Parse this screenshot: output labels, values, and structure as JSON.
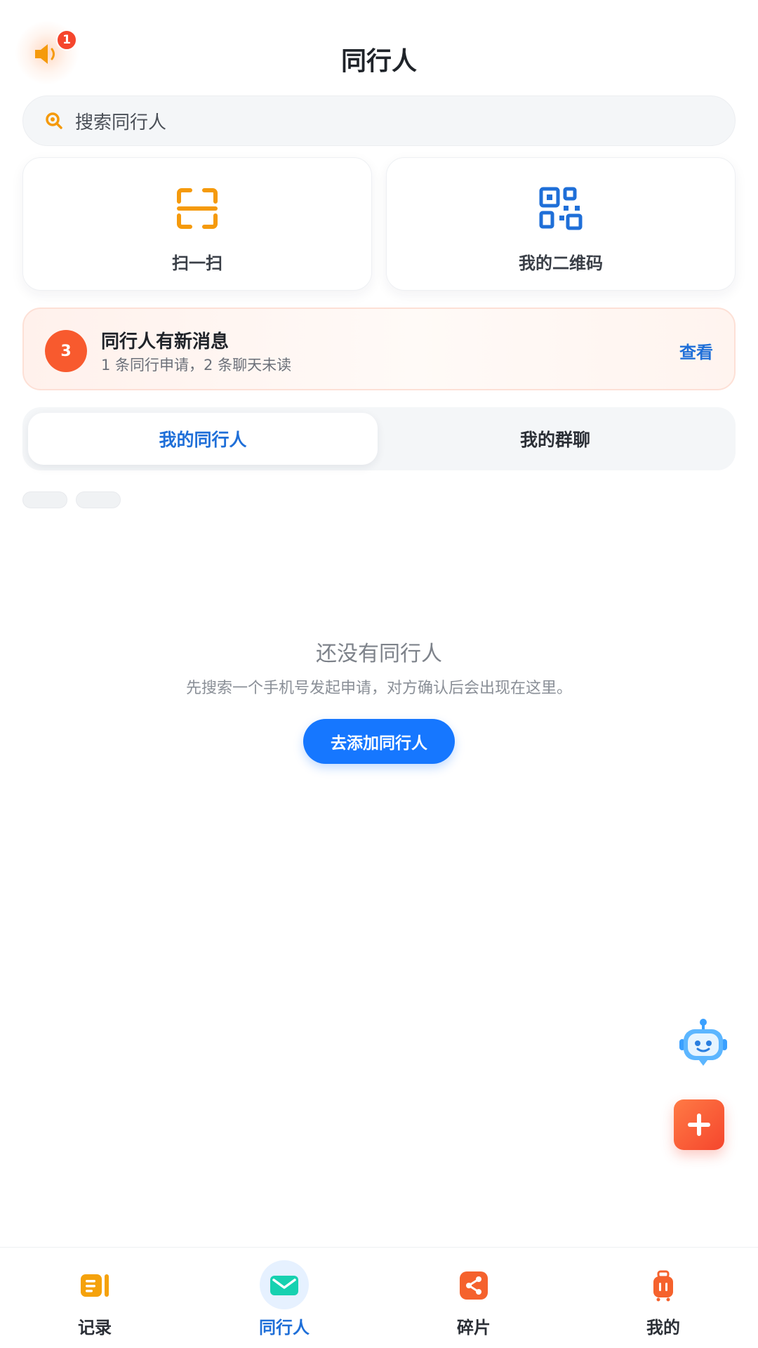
{
  "header": {
    "title": "同行人",
    "notice_badge": "1"
  },
  "search": {
    "placeholder": "搜索同行人"
  },
  "actions": {
    "scan_label": "扫一扫",
    "qr_label": "我的二维码"
  },
  "banner": {
    "count": "3",
    "title": "同行人有新消息",
    "subtitle": "1 条同行申请，2 条聊天未读",
    "action_label": "查看"
  },
  "tabs": {
    "my_companions": "我的同行人",
    "my_groups": "我的群聊",
    "active": "我的同行人"
  },
  "empty_state": {
    "title": "还没有同行人",
    "description": "先搜索一个手机号发起申请，对方确认后会出现在这里。",
    "button_label": "去添加同行人"
  },
  "bottom_nav": {
    "items": [
      {
        "label": "记录",
        "icon": "record-icon"
      },
      {
        "label": "同行人",
        "icon": "mail-icon"
      },
      {
        "label": "碎片",
        "icon": "share-icon"
      },
      {
        "label": "我的",
        "icon": "luggage-icon"
      }
    ],
    "active": "同行人"
  },
  "colors": {
    "primary": "#1677ff",
    "accent_orange": "#f59a0c",
    "badge_red": "#f5462d",
    "qr_blue": "#1f6fd8"
  }
}
